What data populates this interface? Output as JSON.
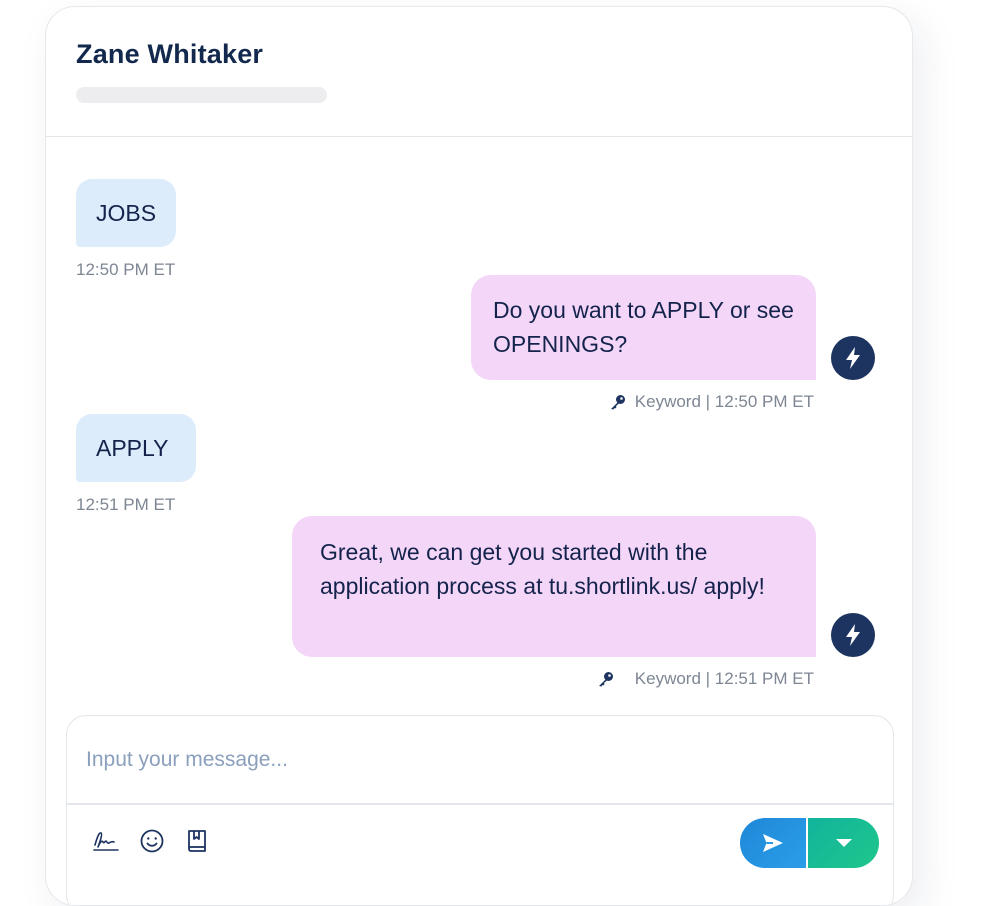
{
  "contact": {
    "name": "Zane Whitaker"
  },
  "messages": [
    {
      "direction": "inbound",
      "text": "JOBS",
      "time": "12:50 PM ET"
    },
    {
      "direction": "outbound",
      "text": "Do you want to APPLY or see OPENINGS?",
      "meta": "Keyword | 12:50 PM ET",
      "icon": "lightning-icon"
    },
    {
      "direction": "inbound",
      "text": "APPLY",
      "time": "12:51 PM ET"
    },
    {
      "direction": "outbound",
      "text": "Great, we can get you started with the application process at tu.shortlink.us/ apply!",
      "meta": "Keyword | 12:51 PM ET",
      "icon": "lightning-icon"
    }
  ],
  "composer": {
    "placeholder": "Input your message...",
    "tools": [
      "signature-icon",
      "emoji-icon",
      "bookmark-book-icon"
    ],
    "send_icon": "send-arrow-icon",
    "options_icon": "caret-down-icon"
  },
  "colors": {
    "inbound_bubble": "#dcecfb",
    "outbound_bubble": "#f4d6f8",
    "brand_navy": "#1d3461",
    "send_blue": "#1f87d8",
    "options_green": "#12b39d"
  }
}
